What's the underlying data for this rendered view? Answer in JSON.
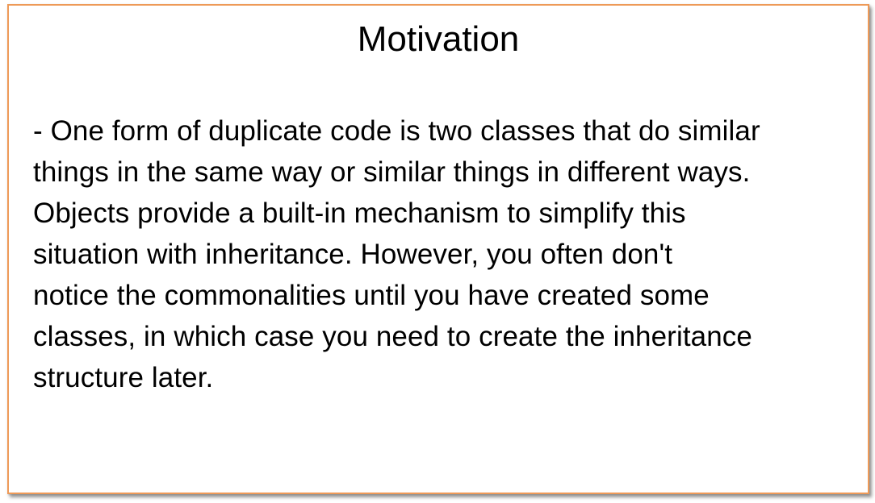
{
  "slide": {
    "title": "Motivation",
    "body": "- One form of duplicate code is two classes that do similar\nthings in the same way or similar things in different ways.\nObjects provide a built-in mechanism to simplify this\nsituation with inheritance. However, you often don't\nnotice the commonalities until you have created some\nclasses, in which case you need to create the inheritance\nstructure later."
  },
  "colors": {
    "border": "#ee9a58",
    "text": "#000000",
    "background": "#ffffff"
  }
}
